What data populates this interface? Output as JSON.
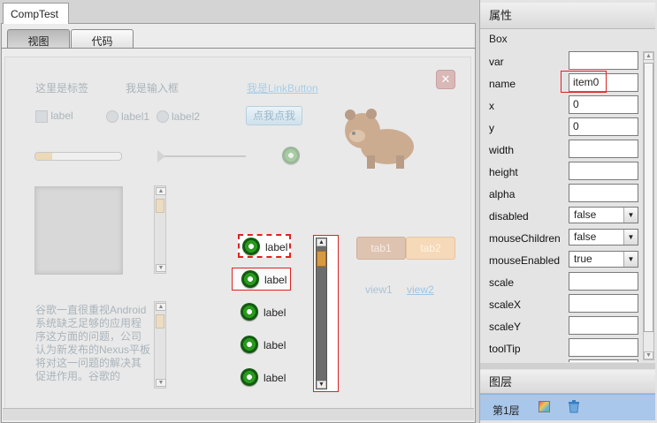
{
  "document_tab": "CompTest",
  "view_tabs": {
    "view": "视图",
    "code": "代码"
  },
  "canvas": {
    "label_text": "这里是标签",
    "input_text": "我是输入框",
    "link_button": "我是LinkButton",
    "button": "点我点我",
    "checkbox_label": "label",
    "radio1_label": "label1",
    "radio2_label": "label2",
    "textarea_text": "谷歌一直很重视Android系统缺乏足够的应用程序这方面的问题，公司认为新发布的Nexus平板将对这一问题的解决其促进作用。谷歌的",
    "list_labels": [
      "label",
      "label",
      "label",
      "label",
      "label"
    ],
    "tabs": [
      "tab1",
      "tab2"
    ],
    "views": [
      "view1",
      "view2"
    ],
    "progress_value": 0.2,
    "slider_value": 0
  },
  "properties": {
    "header": "属性",
    "component": "Box",
    "rows": [
      {
        "name": "var",
        "type": "input",
        "value": ""
      },
      {
        "name": "name",
        "type": "input",
        "value": "item0"
      },
      {
        "name": "x",
        "type": "input",
        "value": "0"
      },
      {
        "name": "y",
        "type": "input",
        "value": "0"
      },
      {
        "name": "width",
        "type": "input",
        "value": ""
      },
      {
        "name": "height",
        "type": "input",
        "value": ""
      },
      {
        "name": "alpha",
        "type": "input",
        "value": ""
      },
      {
        "name": "disabled",
        "type": "select",
        "value": "false"
      },
      {
        "name": "mouseChildren",
        "type": "select",
        "value": "false"
      },
      {
        "name": "mouseEnabled",
        "type": "select",
        "value": "true"
      },
      {
        "name": "scale",
        "type": "input",
        "value": ""
      },
      {
        "name": "scaleX",
        "type": "input",
        "value": ""
      },
      {
        "name": "scaleY",
        "type": "input",
        "value": ""
      },
      {
        "name": "toolTip",
        "type": "input",
        "value": ""
      }
    ]
  },
  "layers": {
    "header": "图层",
    "item": "第1层"
  },
  "colors": {
    "selection": "#dd2222",
    "layer_highlight": "#a9c7ea",
    "ring_green": "#2a9a1f"
  }
}
